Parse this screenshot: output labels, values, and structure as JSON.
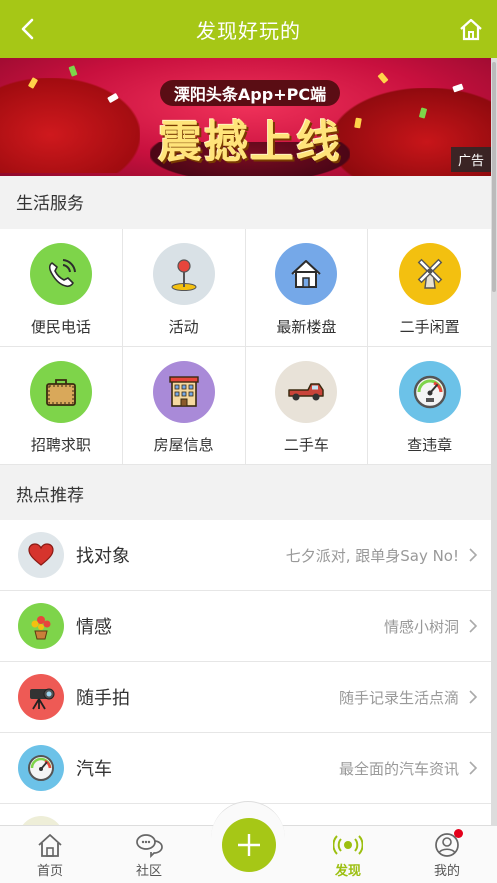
{
  "header": {
    "title": "发现好玩的"
  },
  "banner": {
    "tagline": "溧阳头条App+PC端",
    "headline": "震撼上线",
    "ad_label": "广告"
  },
  "life_services": {
    "title": "生活服务",
    "items": [
      {
        "label": "便民电话",
        "icon": "phone-icon",
        "color": "#7ed44a"
      },
      {
        "label": "活动",
        "icon": "pin-icon",
        "color": "#d9e1e6"
      },
      {
        "label": "最新楼盘",
        "icon": "house-icon",
        "color": "#75a8e8"
      },
      {
        "label": "二手闲置",
        "icon": "windmill-icon",
        "color": "#f3c010"
      },
      {
        "label": "招聘求职",
        "icon": "briefcase-icon",
        "color": "#7ed44a"
      },
      {
        "label": "房屋信息",
        "icon": "building-icon",
        "color": "#a98ad8"
      },
      {
        "label": "二手车",
        "icon": "truck-icon",
        "color": "#e8e2d8"
      },
      {
        "label": "查违章",
        "icon": "speedometer-icon",
        "color": "#6cc2e8"
      }
    ]
  },
  "hot": {
    "title": "热点推荐",
    "items": [
      {
        "name": "找对象",
        "desc": "七夕派对, 跟单身Say No!",
        "icon": "heart-icon",
        "color": "#dfe6ea"
      },
      {
        "name": "情感",
        "desc": "情感小树洞",
        "icon": "flower-icon",
        "color": "#7ed44a"
      },
      {
        "name": "随手拍",
        "desc": "随手记录生活点滴",
        "icon": "camera-icon",
        "color": "#ee5a55"
      },
      {
        "name": "汽车",
        "desc": "最全面的汽车资讯",
        "icon": "gauge-icon",
        "color": "#6cc2e8"
      }
    ]
  },
  "tabbar": {
    "home": "首页",
    "community": "社区",
    "discover": "发现",
    "mine": "我的",
    "active": "discover",
    "accent": "#a6c716"
  }
}
